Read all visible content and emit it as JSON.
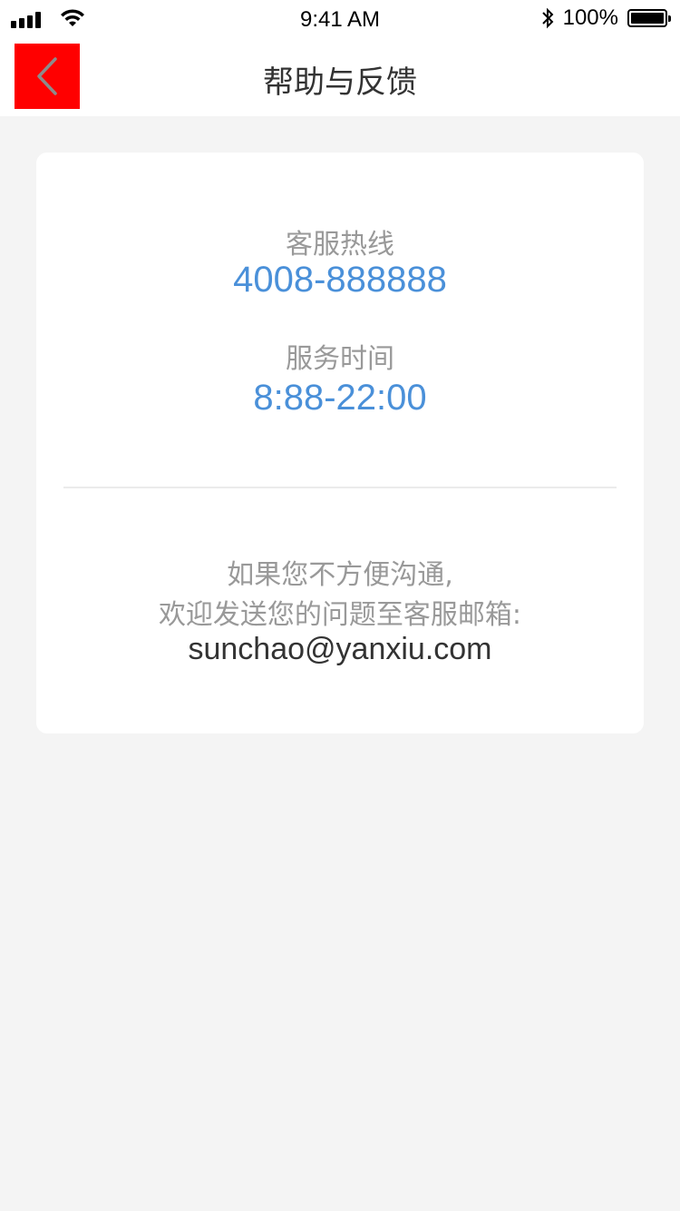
{
  "status_bar": {
    "time": "9:41 AM",
    "battery_percent": "100%",
    "signal_icon": "signal-bars-icon",
    "wifi_icon": "wifi-icon",
    "bluetooth_icon": "bluetooth-icon",
    "battery_icon": "battery-icon"
  },
  "nav": {
    "title": "帮助与反馈",
    "back_icon": "chevron-left-icon",
    "back_button_color": "#ff0000"
  },
  "card": {
    "hotline_label": "客服热线",
    "hotline_number": "4008-888888",
    "hours_label": "服务时间",
    "hours_value": "8:88-22:00",
    "note_line1": "如果您不方便沟通,",
    "note_line2": "欢迎发送您的问题至客服邮箱:",
    "email": "sunchao@yanxiu.com"
  },
  "colors": {
    "accent": "#4a90d9",
    "background": "#f4f4f4",
    "label_gray": "#999999",
    "title_dark": "#333333"
  }
}
